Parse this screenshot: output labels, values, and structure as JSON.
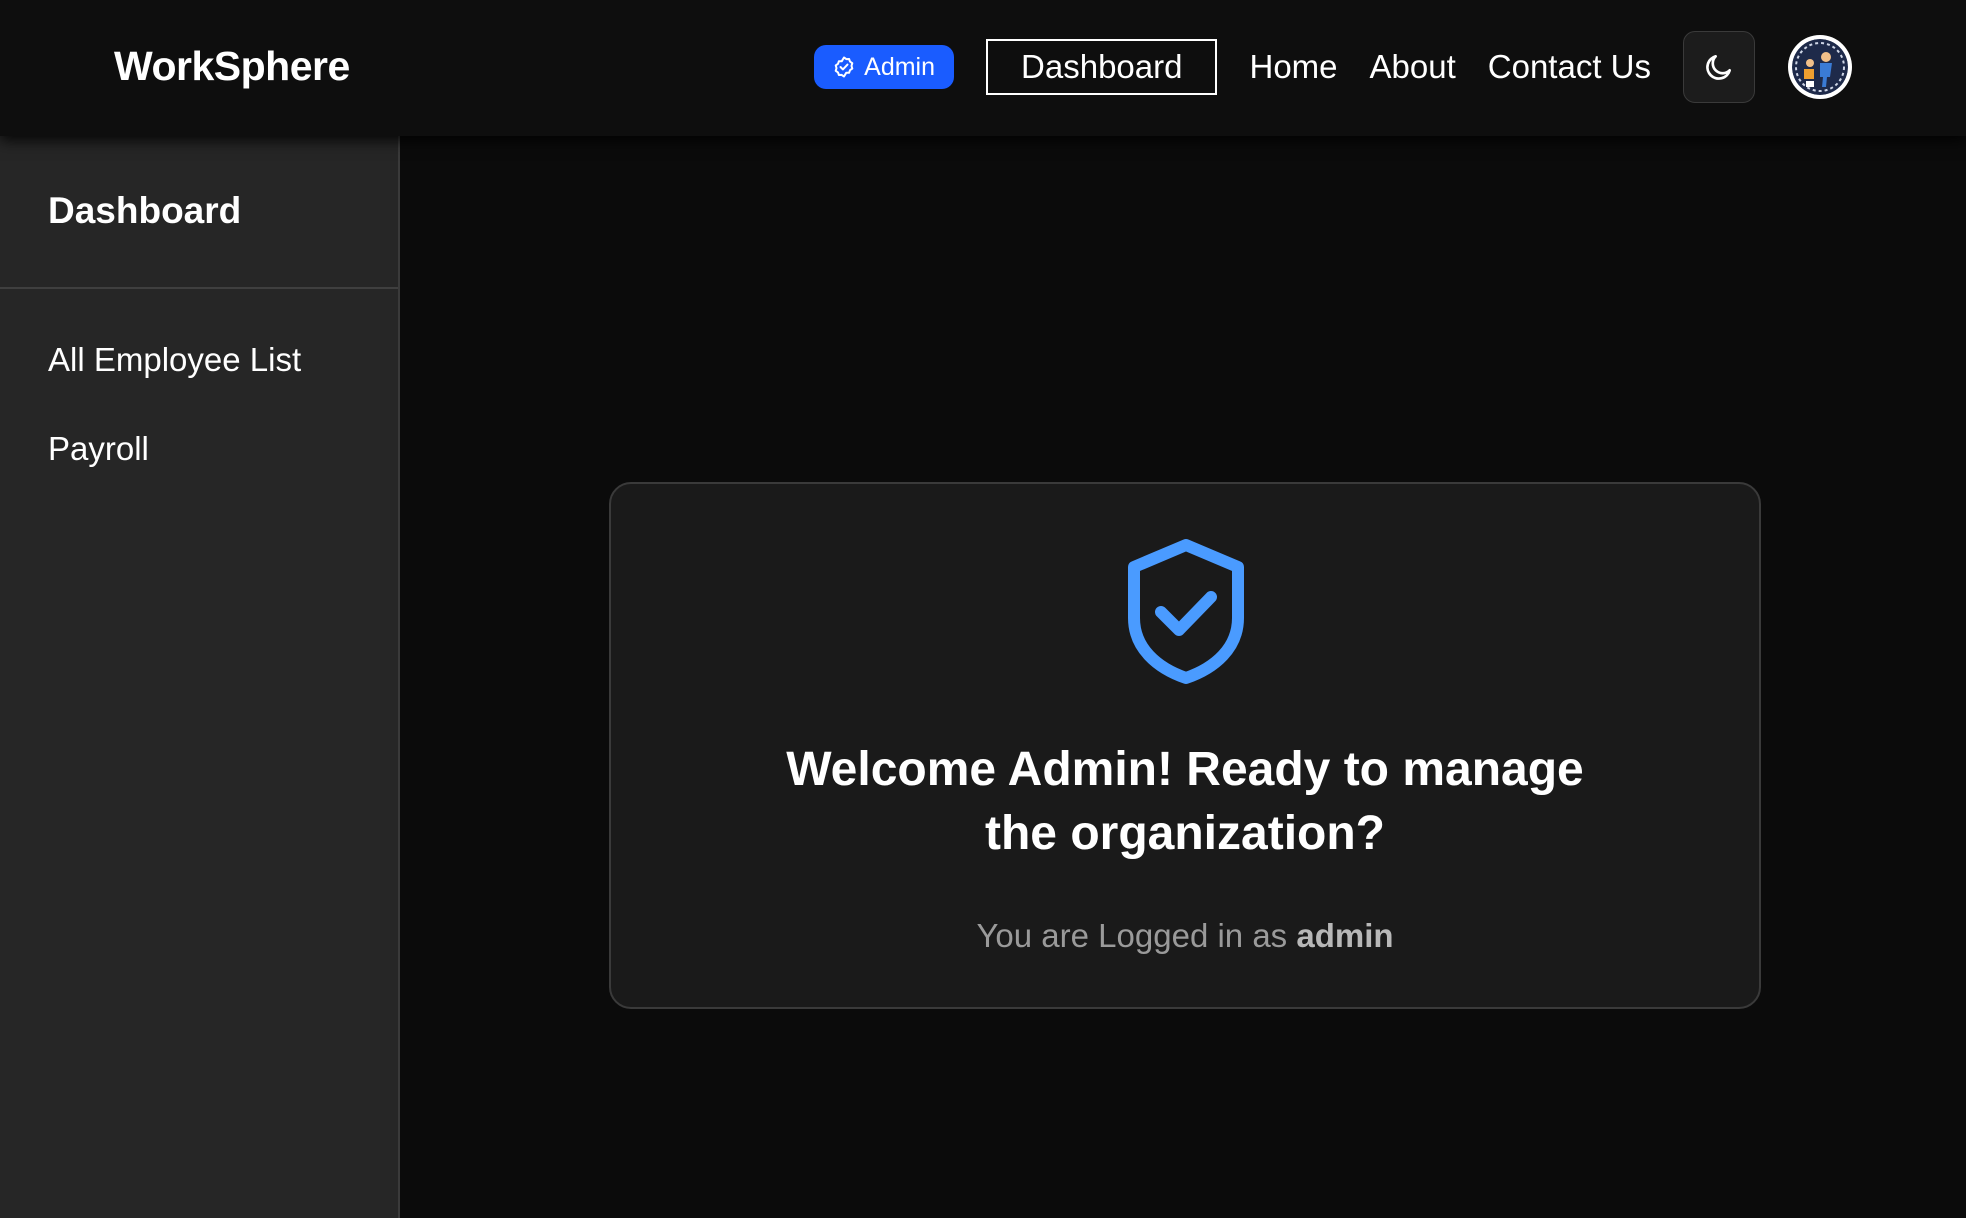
{
  "navbar": {
    "brand": "WorkSphere",
    "role_badge": "Admin",
    "active_link": "Dashboard",
    "links": [
      "Home",
      "About",
      "Contact Us"
    ],
    "theme_toggle_icon": "moon-icon",
    "avatar_icon": "user-avatar"
  },
  "sidebar": {
    "title": "Dashboard",
    "items": [
      {
        "label": "All Employee List"
      },
      {
        "label": "Payroll"
      }
    ]
  },
  "welcome_card": {
    "icon": "shield-check-icon",
    "icon_color": "#4a9bff",
    "heading": "Welcome Admin! Ready to manage the organization?",
    "status_prefix": "You are Logged in as",
    "username": "admin"
  },
  "colors": {
    "accent": "#1a5cff",
    "background": "#0b0b0b",
    "sidebar": "#262626",
    "card": "#1a1a1a"
  }
}
